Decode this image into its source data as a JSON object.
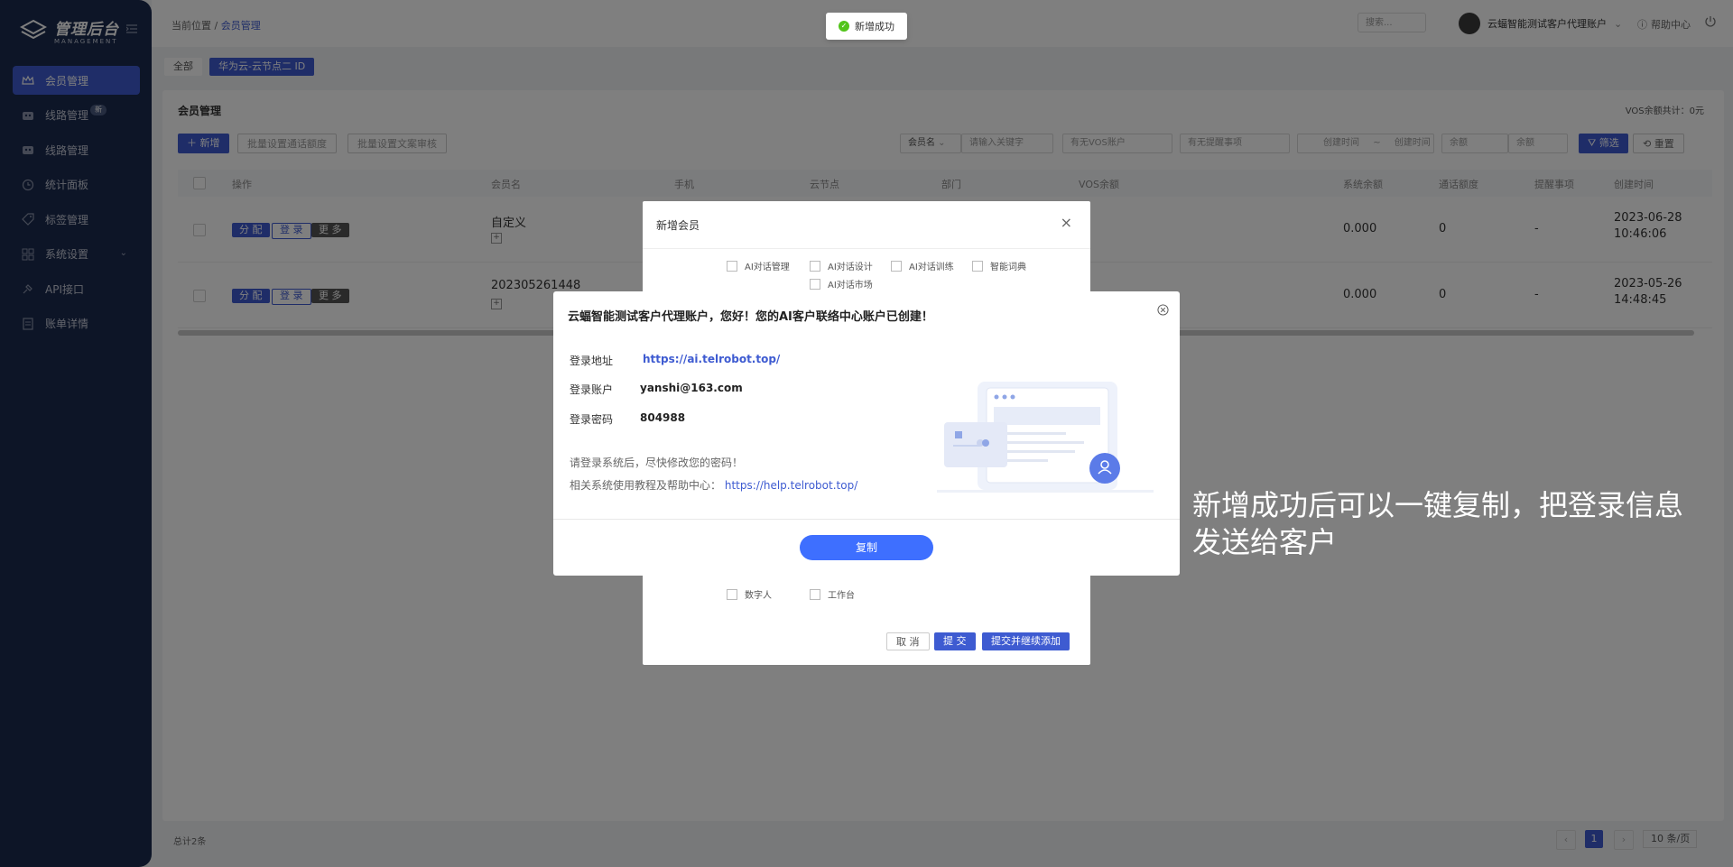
{
  "sidebar": {
    "logo_title": "管理后台",
    "logo_sub": "MANAGEMENT",
    "items": [
      {
        "label": "会员管理",
        "icon": "crown-icon",
        "active": true
      },
      {
        "label": "线路管理",
        "icon": "robot-icon",
        "badge": "新"
      },
      {
        "label": "线路管理",
        "icon": "robot-icon"
      },
      {
        "label": "统计面板",
        "icon": "clock-icon"
      },
      {
        "label": "标签管理",
        "icon": "tag-icon"
      },
      {
        "label": "系统设置",
        "icon": "grid-icon",
        "has_caret": true
      },
      {
        "label": "API接口",
        "icon": "plug-icon"
      },
      {
        "label": "账单详情",
        "icon": "bill-icon"
      }
    ]
  },
  "header": {
    "breadcrumb_prefix": "当前位置",
    "breadcrumb_current": "会员管理",
    "search_placeholder": "搜索...",
    "user_name": "云蝠智能测试客户代理账户",
    "help_label": "帮助中心"
  },
  "tabs": [
    {
      "label": "全部"
    },
    {
      "label": "华为云-云节点二  ID"
    }
  ],
  "toast": {
    "text": "新增成功",
    "color": "#52c41a"
  },
  "card": {
    "title": "会员管理",
    "vos_total": "VOS余额共计：0元",
    "toolbar": {
      "add": "＋ 新增",
      "batch_concurrency": "批量设置通话额度",
      "batch_text": "批量设置文案审核",
      "member_select": "会员名",
      "keyword_placeholder": "请输入关键字",
      "vos_select": "有无VOS账户",
      "remind_select": "有无提醒事项",
      "date_start": "创建时间",
      "date_end": "创建时间",
      "balance_min": "余额",
      "balance_max": "余额",
      "filter": "筛选",
      "reset": "重置"
    },
    "columns": [
      "操作",
      "会员名",
      "手机",
      "云节点",
      "部门",
      "VOS余额",
      "系统余额",
      "通话额度",
      "提醒事项",
      "创建时间"
    ],
    "row_actions": {
      "assign": "分 配",
      "login": "登 录",
      "more": "更 多"
    },
    "rows": [
      {
        "name": "自定义",
        "balance": "0.000",
        "quota": "0",
        "remind": "-",
        "date": "2023-06-28",
        "time": "10:46:06"
      },
      {
        "name": "202305261448",
        "balance": "0.000",
        "quota": "0",
        "remind": "-",
        "date": "2023-05-26",
        "time": "14:48:45"
      }
    ]
  },
  "footer": {
    "total": "总计2条",
    "page": "1",
    "page_size": "10 条/页"
  },
  "add_member_modal": {
    "title": "新增会员",
    "checkboxes_top": [
      "AI对话管理",
      "AI对话设计",
      "AI对话训练",
      "智能词典",
      "AI对话市场"
    ],
    "checkboxes_bottom": [
      "数字人",
      "工作台"
    ],
    "cancel": "取 消",
    "submit": "提 交",
    "submit_continue": "提交并继续添加"
  },
  "success_modal": {
    "title": "云蝠智能测试客户代理账户，您好！您的AI客户联络中心账户已创建！",
    "login_url_label": "登录地址",
    "login_url": "https://ai.telrobot.top/",
    "account_label": "登录账户",
    "account": "yanshi@163.com",
    "password_label": "登录密码",
    "password": "804988",
    "note1": "请登录系统后，尽快修改您的密码！",
    "note2_prefix": "相关系统使用教程及帮助中心：",
    "help_url": "https://help.telrobot.top/",
    "copy": "复制"
  },
  "annotation": "新增成功后可以一键复制，把登录信息发送给客户",
  "colors": {
    "primary": "#3e5bd1",
    "sidebar": "#1b2a4e",
    "copy_button": "#3e6fff"
  }
}
